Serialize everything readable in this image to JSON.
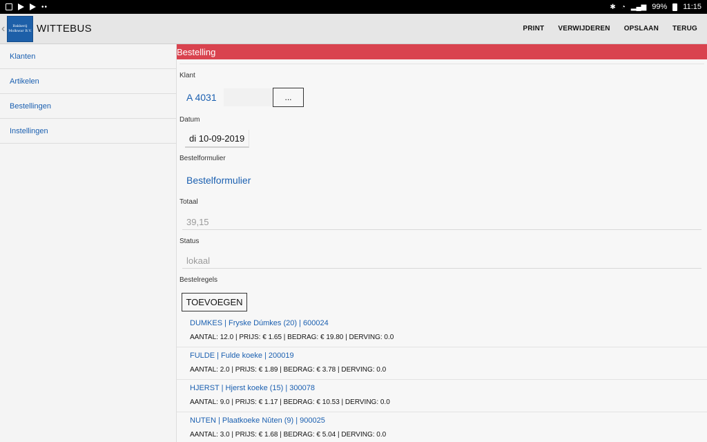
{
  "status_bar": {
    "battery": "99%",
    "time": "11:15"
  },
  "header": {
    "logo_line1": "Bakkerij",
    "logo_line2": "Molkwar B.V.",
    "title": "WITTEBUS",
    "actions": [
      "PRINT",
      "VERWIJDEREN",
      "OPSLAAN",
      "TERUG"
    ]
  },
  "sidebar": {
    "items": [
      "Klanten",
      "Artikelen",
      "Bestellingen",
      "Instellingen"
    ]
  },
  "main": {
    "section_title": "Bestelling",
    "klant": {
      "label": "Klant",
      "value": "A 4031",
      "picker_label": "..."
    },
    "datum": {
      "label": "Datum",
      "value": "di 10-09-2019"
    },
    "bestelformulier": {
      "label": "Bestelformulier",
      "value": "Bestelformulier"
    },
    "totaal": {
      "label": "Totaal",
      "value": "39,15"
    },
    "status": {
      "label": "Status",
      "value": "lokaal"
    },
    "bestelregels": {
      "label": "Bestelregels",
      "add_button": "TOEVOEGEN"
    },
    "orders": [
      {
        "title": "DUMKES | Fryske Dúmkes (20) | 600024",
        "detail": "AANTAL: 12.0 | PRIJS: € 1.65 | BEDRAG: € 19.80 | DERVING: 0.0"
      },
      {
        "title": "FULDE | Fulde koeke | 200019",
        "detail": "AANTAL: 2.0 | PRIJS: € 1.89 | BEDRAG: € 3.78 | DERVING: 0.0"
      },
      {
        "title": "HJERST | Hjerst koeke (15) | 300078",
        "detail": "AANTAL: 9.0 | PRIJS: € 1.17 | BEDRAG: € 10.53 | DERVING: 0.0"
      },
      {
        "title": "NUTEN | Plaatkoeke Nûten (9) | 900025",
        "detail": "AANTAL: 3.0 | PRIJS: € 1.68 | BEDRAG: € 5.04 | DERVING: 0.0"
      }
    ]
  },
  "colors": {
    "section_header": "#d9434f",
    "link": "#1a5fb0",
    "logo_bg": "#1d5fa8"
  }
}
